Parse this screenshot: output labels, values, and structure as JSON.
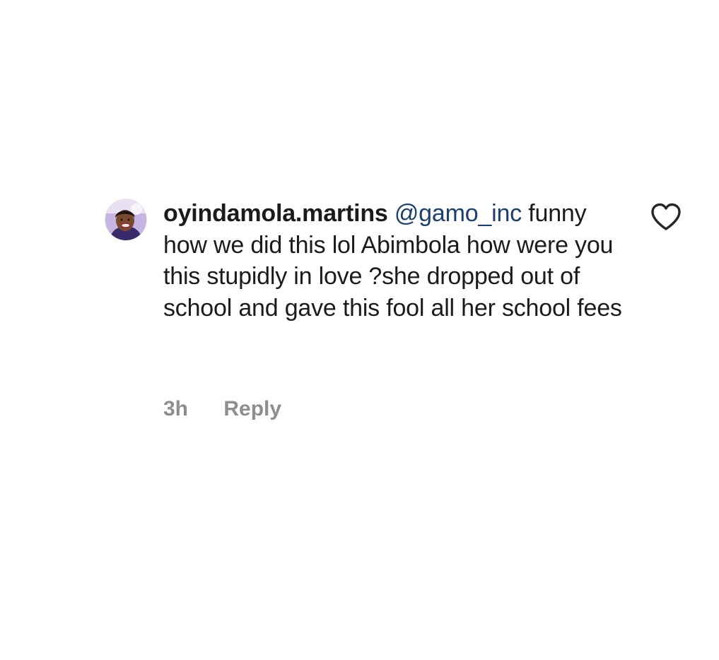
{
  "comment": {
    "username": "oyindamola.martins",
    "mention": "@gamo_inc",
    "text": "funny how we did this lol Abimbola how were you this stupidly in love ?she dropped out of school and gave this fool all her school fees",
    "time": "3h",
    "reply_label": "Reply",
    "avatar_icon": "profile-photo",
    "like_icon": "heart-outline-icon"
  },
  "colors": {
    "background": "#ffffff",
    "text": "#1b1b1b",
    "mention": "#1d3f6e",
    "meta": "#8e8e8e",
    "icon": "#262626"
  }
}
